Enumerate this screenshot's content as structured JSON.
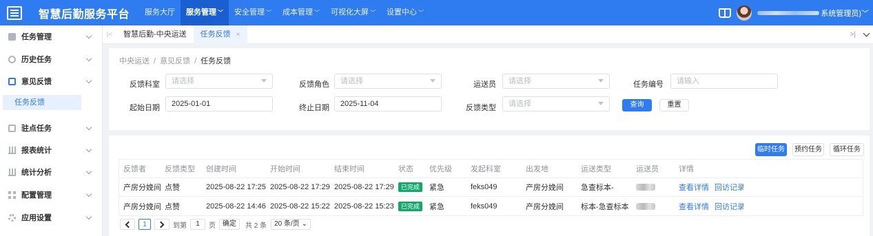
{
  "app": {
    "title": "智慧后勤服务平台"
  },
  "topnav": [
    {
      "label": "服务大厅",
      "caret": ""
    },
    {
      "label": "服务管理",
      "caret": "﹀"
    },
    {
      "label": "安全管理",
      "caret": "﹀"
    },
    {
      "label": "成本管理",
      "caret": "﹀"
    },
    {
      "label": "可视化大屏",
      "caret": "﹀"
    },
    {
      "label": "设置中心",
      "caret": "﹀"
    }
  ],
  "user": {
    "role": "系统管理员)﹀"
  },
  "sidebar": {
    "items": [
      {
        "label": "任务管理",
        "icon": "task-icon"
      },
      {
        "label": "历史任务",
        "icon": "history-icon"
      },
      {
        "label": "意见反馈",
        "icon": "feedback-icon"
      },
      {
        "label": "驻点任务",
        "icon": "station-icon"
      },
      {
        "label": "报表统计",
        "icon": "report-icon"
      },
      {
        "label": "统计分析",
        "icon": "analysis-icon"
      },
      {
        "label": "配置管理",
        "icon": "config-icon"
      },
      {
        "label": "应用设置",
        "icon": "settings-icon"
      }
    ],
    "sub_active": "任务反馈"
  },
  "tabs": {
    "prev": "|<",
    "items": [
      "智慧后勤-中央运送",
      "任务反馈"
    ],
    "close": "×",
    "right": ">|"
  },
  "breadcrumb": [
    "中央运送",
    "意见反馈",
    "任务反馈"
  ],
  "filters": {
    "dept_label": "反馈科室",
    "dept_placeholder": "请选择",
    "role_label": "反馈角色",
    "role_placeholder": "请选择",
    "courier_label": "运送员",
    "courier_placeholder": "请选择",
    "taskno_label": "任务编号",
    "taskno_placeholder": "请输入",
    "start_label": "起始日期",
    "start_value": "2025-01-01",
    "end_label": "终止日期",
    "end_value": "2025-11-04",
    "type_label": "反馈类型",
    "type_placeholder": "请选择",
    "query_btn": "查询",
    "reset_btn": "重置"
  },
  "actions": {
    "temp": "临时任务",
    "reserve": "预约任务",
    "cycle": "循环任务"
  },
  "table": {
    "headers": [
      "反馈者",
      "反馈类型",
      "创建时间",
      "开始时间",
      "结束时间",
      "状态",
      "优先级",
      "发起科室",
      "出发地",
      "运送类型",
      "运送员",
      "详情"
    ],
    "rows": [
      {
        "c0": "产房分娩间",
        "c1": "点赞",
        "c2": "2025-08-22 17:25",
        "c3": "2025-08-22 17:29",
        "c4": "2025-08-22 17:29",
        "c5": "已完成",
        "c6": "紧急",
        "c7": "feks049",
        "c8": "产房分娩间",
        "c9": "急查标本-",
        "d1": "查看详情",
        "d2": "回访记录"
      },
      {
        "c0": "产房分娩间",
        "c1": "点赞",
        "c2": "2025-08-22 14:46",
        "c3": "2025-08-22 15:22",
        "c4": "2025-08-22 15:23",
        "c5": "已完成",
        "c6": "紧急",
        "c7": "feks049",
        "c8": "产房分娩间",
        "c9": "标本-急查标本",
        "d1": "查看详情",
        "d2": "回访记录"
      }
    ]
  },
  "pager": {
    "page": "1",
    "goto": "到第",
    "input": "1",
    "page_unit": "页",
    "confirm": "确定",
    "total": "共 2 条",
    "size": "20 条/页 ⌄"
  },
  "colors": {
    "primary": "#2f7bf0",
    "success": "#13a86b"
  }
}
